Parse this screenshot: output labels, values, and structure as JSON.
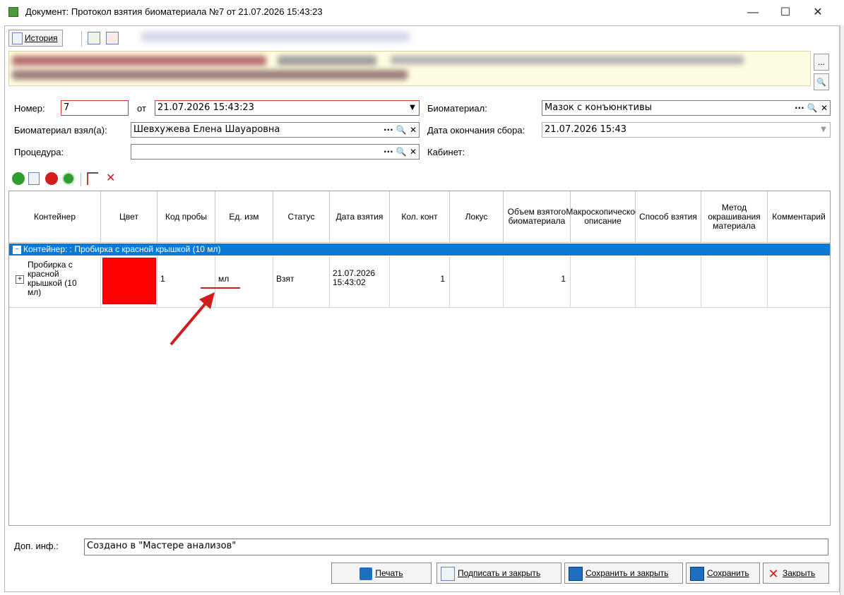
{
  "window": {
    "title": "Документ: Протокол взятия биоматериала №7 от 21.07.2026 15:43:23",
    "min": "—",
    "max": "☐",
    "close": "✕"
  },
  "toolbar": {
    "history_label": "История"
  },
  "banner": {
    "more_label": "...",
    "search_label": "🔍"
  },
  "form": {
    "number_label": "Номер:",
    "number_value": "7",
    "from_label": "от",
    "date_value": "21.07.2026 15:43:23",
    "biomaterial_label": "Биоматериал:",
    "biomaterial_value": "Мазок с конъюнктивы",
    "taken_by_label": "Биоматериал взял(а):",
    "taken_by_value": "Шевхужева Елена Шауаровна",
    "end_date_label": "Дата окончания сбора:",
    "end_date_value": "21.07.2026 15:43",
    "procedure_label": "Процедура:",
    "procedure_value": "",
    "cabinet_label": "Кабинет:"
  },
  "grid": {
    "columns": [
      "Контейнер",
      "Цвет",
      "Код пробы",
      "Ед. изм",
      "Статус",
      "Дата взятия",
      "Кол. конт",
      "Локус",
      "Объем взятого биоматериала",
      "Макроскопическое описание",
      "Способ взятия",
      "Метод окрашивания материала",
      "Комментарий"
    ],
    "group_label": "Контейнер: : Пробирка с красной крышкой (10 мл)",
    "row": {
      "container": "Пробирка с красной крышкой (10 мл)",
      "color": "#ff0000",
      "code": "1",
      "unit": "мл",
      "status": "Взят",
      "date": "21.07.2026 15:43:02",
      "count": "1",
      "locus": "",
      "volume": "1",
      "macro": "",
      "method": "",
      "stain": "",
      "comment": ""
    }
  },
  "footer": {
    "doc_info_label": "Доп. инф.:",
    "doc_info_value": "Создано в \"Мастере анализов\"",
    "print_label": "Печать",
    "sign_close_label": "Подписать и закрыть",
    "save_close_label": "Сохранить и закрыть",
    "save_label": "Сохранить",
    "close_label": "Закрыть"
  },
  "colors": {
    "accent": "#0a79d6",
    "annotation": "#d01c1c",
    "banner_bg": "#fffde1"
  }
}
